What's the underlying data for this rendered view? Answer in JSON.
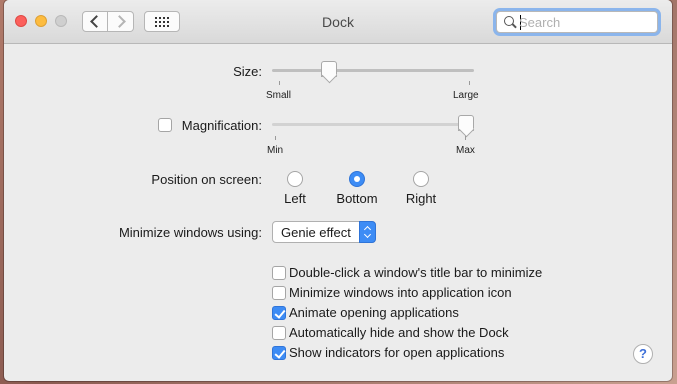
{
  "window": {
    "title": "Dock"
  },
  "search": {
    "placeholder": "Search",
    "value": ""
  },
  "size": {
    "label": "Size:",
    "min_label": "Small",
    "max_label": "Large",
    "value": 0.26
  },
  "magnification": {
    "label": "Magnification:",
    "checked": false,
    "min_label": "Min",
    "max_label": "Max",
    "value": 1.0
  },
  "position": {
    "label": "Position on screen:",
    "options": [
      "Left",
      "Bottom",
      "Right"
    ],
    "selected": "Bottom"
  },
  "minimize": {
    "label": "Minimize windows using:",
    "selected": "Genie effect"
  },
  "checkboxes": [
    {
      "label": "Double-click a window's title bar to minimize",
      "checked": false
    },
    {
      "label": "Minimize windows into application icon",
      "checked": false
    },
    {
      "label": "Animate opening applications",
      "checked": true
    },
    {
      "label": "Automatically hide and show the Dock",
      "checked": false
    },
    {
      "label": "Show indicators for open applications",
      "checked": true
    }
  ],
  "help": {
    "label": "?"
  },
  "colors": {
    "accent": "#3d8cf5",
    "focus_ring": "#8bb5ec"
  }
}
